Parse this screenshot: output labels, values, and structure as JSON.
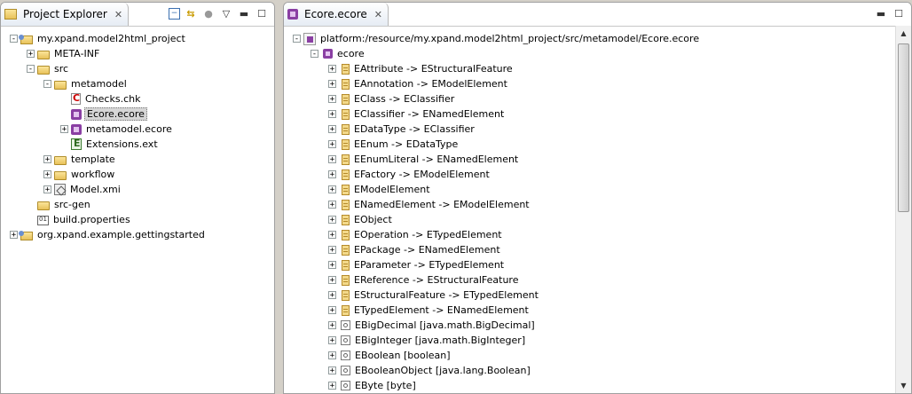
{
  "left_panel": {
    "tab_title": "Project Explorer",
    "tree": [
      {
        "label": "my.xpand.model2html_project",
        "icon": "project-icon",
        "level": 0,
        "expander": "-"
      },
      {
        "label": "META-INF",
        "icon": "folder-icon",
        "level": 1,
        "expander": "+"
      },
      {
        "label": "src",
        "icon": "folder-icon",
        "level": 1,
        "expander": "-"
      },
      {
        "label": "metamodel",
        "icon": "folder-icon",
        "level": 2,
        "expander": "-"
      },
      {
        "label": "Checks.chk",
        "icon": "check-file-icon",
        "level": 3,
        "expander": ""
      },
      {
        "label": "Ecore.ecore",
        "icon": "ecore-file-icon",
        "level": 3,
        "expander": "",
        "selected": true
      },
      {
        "label": "metamodel.ecore",
        "icon": "ecore-file-icon",
        "level": 3,
        "expander": "+"
      },
      {
        "label": "Extensions.ext",
        "icon": "extension-file-icon",
        "level": 3,
        "expander": ""
      },
      {
        "label": "template",
        "icon": "folder-icon",
        "level": 2,
        "expander": "+"
      },
      {
        "label": "workflow",
        "icon": "folder-icon",
        "level": 2,
        "expander": "+"
      },
      {
        "label": "Model.xmi",
        "icon": "xmi-file-icon",
        "level": 2,
        "expander": "+"
      },
      {
        "label": "src-gen",
        "icon": "folder-icon",
        "level": 1,
        "expander": ""
      },
      {
        "label": "build.properties",
        "icon": "properties-file-icon",
        "level": 1,
        "expander": ""
      },
      {
        "label": "org.xpand.example.gettingstarted",
        "icon": "project-icon",
        "level": 0,
        "expander": "+"
      }
    ]
  },
  "editor": {
    "tab_title": "Ecore.ecore",
    "resource": "platform:/resource/my.xpand.model2html_project/src/metamodel/Ecore.ecore",
    "package": "ecore",
    "items": [
      {
        "label": "EAttribute -> EStructuralFeature",
        "kind": "class"
      },
      {
        "label": "EAnnotation -> EModelElement",
        "kind": "class"
      },
      {
        "label": "EClass -> EClassifier",
        "kind": "class"
      },
      {
        "label": "EClassifier -> ENamedElement",
        "kind": "class"
      },
      {
        "label": "EDataType -> EClassifier",
        "kind": "class"
      },
      {
        "label": "EEnum -> EDataType",
        "kind": "class"
      },
      {
        "label": "EEnumLiteral -> ENamedElement",
        "kind": "class"
      },
      {
        "label": "EFactory -> EModelElement",
        "kind": "class"
      },
      {
        "label": "EModelElement",
        "kind": "class"
      },
      {
        "label": "ENamedElement -> EModelElement",
        "kind": "class"
      },
      {
        "label": "EObject",
        "kind": "class"
      },
      {
        "label": "EOperation -> ETypedElement",
        "kind": "class"
      },
      {
        "label": "EPackage -> ENamedElement",
        "kind": "class"
      },
      {
        "label": "EParameter -> ETypedElement",
        "kind": "class"
      },
      {
        "label": "EReference -> EStructuralFeature",
        "kind": "class"
      },
      {
        "label": "EStructuralFeature -> ETypedElement",
        "kind": "class"
      },
      {
        "label": "ETypedElement -> ENamedElement",
        "kind": "class"
      },
      {
        "label": "EBigDecimal [java.math.BigDecimal]",
        "kind": "datatype"
      },
      {
        "label": "EBigInteger [java.math.BigInteger]",
        "kind": "datatype"
      },
      {
        "label": "EBoolean [boolean]",
        "kind": "datatype"
      },
      {
        "label": "EBooleanObject [java.lang.Boolean]",
        "kind": "datatype"
      },
      {
        "label": "EByte [byte]",
        "kind": "datatype"
      }
    ]
  }
}
